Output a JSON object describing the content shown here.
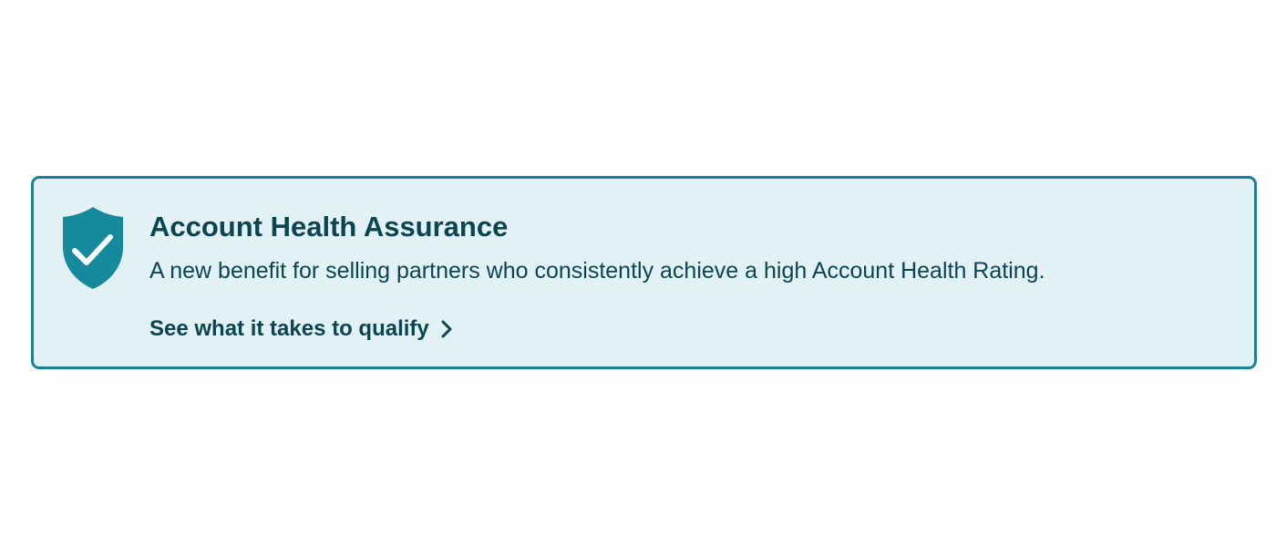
{
  "banner": {
    "title": "Account Health Assurance",
    "description": "A new benefit for selling partners who consistently achieve a high Account Health Rating.",
    "link_label": "See what it takes to qualify",
    "icon": "shield-check-icon",
    "link_icon": "chevron-right-icon"
  },
  "colors": {
    "border": "#1c8196",
    "background": "#e2f1f4",
    "text": "#0b4550",
    "shield": "#148a9c"
  }
}
